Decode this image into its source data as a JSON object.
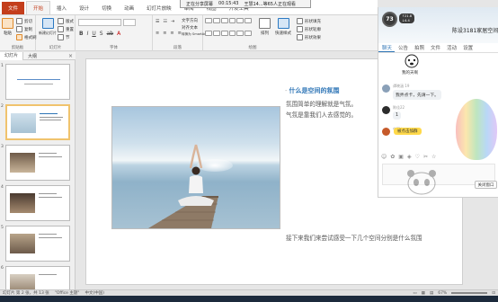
{
  "share_bar": {
    "label": "正在分享屏幕",
    "time": "00:15:43",
    "viewers": "王慧14...等65人正在观看"
  },
  "ribbon": {
    "tabs": [
      "文件",
      "开始",
      "插入",
      "设计",
      "切换",
      "动画",
      "幻灯片放映",
      "审阅",
      "视图",
      "开发工具"
    ],
    "clipboard": {
      "paste": "粘贴",
      "cut": "剪切",
      "copy": "复制",
      "format_painter": "格式刷",
      "label": "剪贴板"
    },
    "slides": {
      "new_slide": "新建幻灯片",
      "layout": "版式",
      "reset": "重置",
      "section": "节",
      "label": "幻灯片"
    },
    "font": {
      "label": "字体"
    },
    "paragraph": {
      "text_direction": "文字方向",
      "align_text": "对齐文本",
      "smartart": "转换为 SmartArt",
      "label": "段落"
    },
    "drawing": {
      "arrange": "排列",
      "quick_styles": "快速样式",
      "shape_fill": "形状填充",
      "shape_outline": "形状轮廓",
      "shape_effects": "形状效果",
      "label": "绘图"
    }
  },
  "slides_panel": {
    "tabs": [
      "幻灯片",
      "大纲"
    ],
    "numbers": [
      "1",
      "2",
      "3",
      "4",
      "5",
      "6"
    ]
  },
  "slide": {
    "title": "什么是空间的氛围",
    "title_dash": "-",
    "body_lines": [
      "氛围简单的理解就是气氛。",
      "气氛是靠我们人去感觉的。"
    ],
    "bottom_text": "接下来我们来尝试感受一下几个空间分别是什么氛围"
  },
  "chat": {
    "badge": "73",
    "net_up": "21.8",
    "net_down": "4.4",
    "live_title": "陈设3181家居空间",
    "tabs": [
      "聊天",
      "公告",
      "拍照",
      "文件",
      "活动",
      "设置"
    ],
    "emoji_caption": "我的天啊",
    "messages": [
      {
        "sender": "谭晓涵 19",
        "text": "我弄点卡，先请一下。"
      },
      {
        "sender": "陈佳22",
        "text": "1"
      },
      {
        "sender": "中国心",
        "text": "我"
      }
    ],
    "highlight": "被点击加群",
    "close_label": "关闭窗口"
  },
  "status_bar": {
    "slide_info": "幻灯片 第 2 张，共 13 张",
    "theme": "\"Office 主题\"",
    "language": "中文(中国)",
    "zoom": "67%"
  },
  "colors": {
    "accent": "#c43e1c",
    "title_blue": "#2e75b6",
    "highlight": "#ffd94a"
  }
}
